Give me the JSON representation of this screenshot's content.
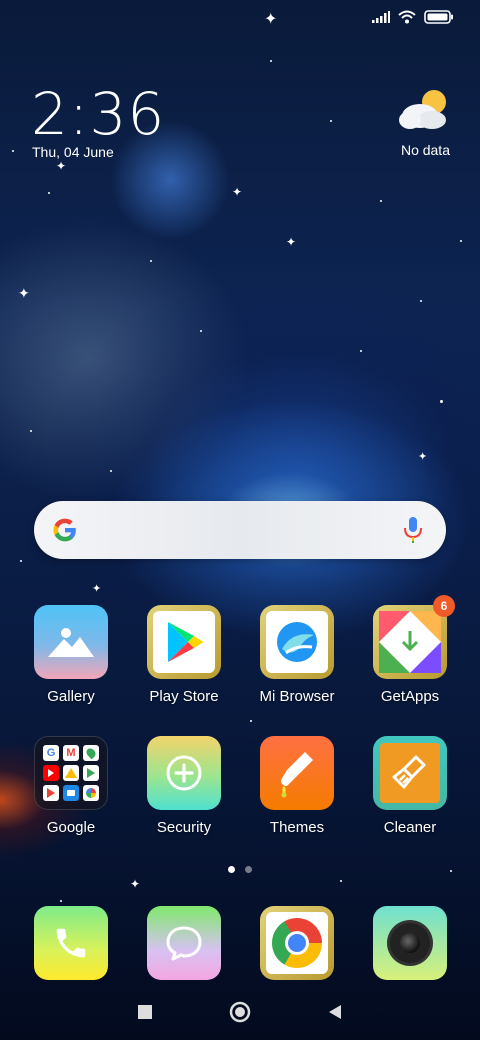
{
  "status_bar": {
    "icons": [
      "signal-icon",
      "wifi-icon",
      "battery-icon"
    ]
  },
  "clock": {
    "time": "2:36",
    "date": "Thu, 04 June"
  },
  "weather": {
    "icon": "partly-cloudy-icon",
    "text": "No data"
  },
  "search": {
    "icons": [
      "google-g-icon",
      "microphone-icon"
    ]
  },
  "apps": [
    {
      "label": "Gallery",
      "icon": "gallery-icon"
    },
    {
      "label": "Play Store",
      "icon": "play-store-icon"
    },
    {
      "label": "Mi Browser",
      "icon": "mi-browser-icon"
    },
    {
      "label": "GetApps",
      "icon": "getapps-icon",
      "badge": "6"
    },
    {
      "label": "Google",
      "icon": "google-folder-icon"
    },
    {
      "label": "Security",
      "icon": "security-icon"
    },
    {
      "label": "Themes",
      "icon": "themes-icon"
    },
    {
      "label": "Cleaner",
      "icon": "cleaner-icon"
    }
  ],
  "page_indicator": {
    "pages": 2,
    "current": 1
  },
  "dock": [
    {
      "icon": "phone-icon"
    },
    {
      "icon": "messages-icon"
    },
    {
      "icon": "chrome-icon"
    },
    {
      "icon": "camera-icon"
    }
  ],
  "nav": [
    "recents-button",
    "home-button",
    "back-button"
  ],
  "colors": {
    "badge": "#f05a28",
    "google_blue": "#4285F4",
    "google_red": "#EA4335",
    "google_yellow": "#FBBC05",
    "google_green": "#34A853"
  }
}
